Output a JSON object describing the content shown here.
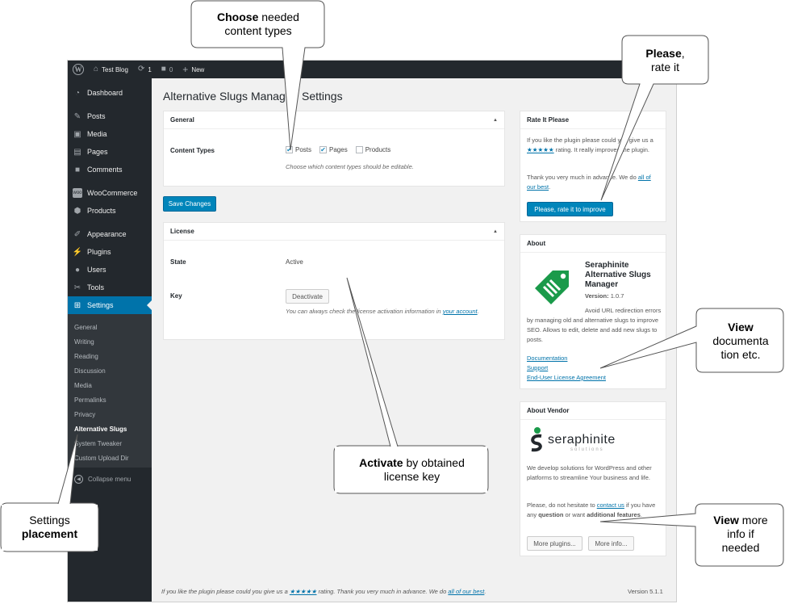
{
  "adminbar": {
    "site_name": "Test Blog",
    "updates_count": "1",
    "comments_count": "0",
    "new_label": "New"
  },
  "sidebar": {
    "items": [
      {
        "label": "Dashboard",
        "icon": "dashboard-icon"
      },
      {
        "label": "Posts",
        "icon": "pin-icon"
      },
      {
        "label": "Media",
        "icon": "media-icon"
      },
      {
        "label": "Pages",
        "icon": "pages-icon"
      },
      {
        "label": "Comments",
        "icon": "comment-icon"
      },
      {
        "label": "WooCommerce",
        "icon": "woo-icon"
      },
      {
        "label": "Products",
        "icon": "box-icon"
      },
      {
        "label": "Appearance",
        "icon": "brush-icon"
      },
      {
        "label": "Plugins",
        "icon": "plug-icon"
      },
      {
        "label": "Users",
        "icon": "user-icon"
      },
      {
        "label": "Tools",
        "icon": "wrench-icon"
      },
      {
        "label": "Settings",
        "icon": "settings-icon"
      }
    ],
    "submenu": [
      "General",
      "Writing",
      "Reading",
      "Discussion",
      "Media",
      "Permalinks",
      "Privacy",
      "Alternative Slugs",
      "System Tweaker",
      "Custom Upload Dir"
    ],
    "collapse_label": "Collapse menu"
  },
  "page_title": "Alternative Slugs Manager: Settings",
  "general": {
    "title": "General",
    "content_types_label": "Content Types",
    "options": [
      {
        "label": "Posts",
        "checked": true
      },
      {
        "label": "Pages",
        "checked": true
      },
      {
        "label": "Products",
        "checked": false
      }
    ],
    "description": "Choose which content types should be editable."
  },
  "save_button": "Save Changes",
  "license": {
    "title": "License",
    "state_label": "State",
    "state_value": "Active",
    "key_label": "Key",
    "deactivate_button": "Deactivate",
    "desc_prefix": "You can always check the license activation information in ",
    "desc_link": "your account",
    "desc_suffix": "."
  },
  "rate": {
    "title": "Rate It Please",
    "text1": "If you like the plugin please could you give us a ",
    "stars": "★★★★★",
    "text2": " rating. It really improves the plugin.",
    "thanks_prefix": "Thank you very much in advance. We do ",
    "thanks_link": "all of our best",
    "thanks_suffix": ".",
    "button": "Please, rate it to improve"
  },
  "about": {
    "title": "About",
    "name": "Seraphinite Alternative Slugs Manager",
    "version_label": "Version:",
    "version": "1.0.7",
    "description": "Avoid URL redirection errors by managing old and alternative slugs to improve SEO. Allows to edit, delete and add new slugs to posts.",
    "links": [
      "Documentation",
      "Support",
      "End-User License Agreement"
    ]
  },
  "vendor": {
    "title": "About Vendor",
    "logo_text": "seraphinite",
    "logo_sub": "solutions",
    "text": "We develop solutions for WordPress and other platforms to streamline Your business and life.",
    "hesitate_prefix": "Please, do not hesitate to ",
    "contact_link": "contact us",
    "hesitate_mid": " if you have any ",
    "question": "question",
    "hesitate_mid2": " or want ",
    "additional": "additional features",
    "hesitate_suffix": ".",
    "more_plugins": "More plugins...",
    "more_info": "More info..."
  },
  "footer": {
    "prefix": "If you like the plugin please could you give us a ",
    "stars": "★★★★★",
    "mid": " rating. Thank you very much in advance. We do ",
    "link": "all of our best",
    "suffix": ".",
    "version": "Version 5.1.1"
  },
  "callouts": {
    "choose": {
      "bold": "Choose",
      "rest1": " needed",
      "rest2": "content types"
    },
    "rate": {
      "bold": "Please",
      "rest1": ",",
      "rest2": "rate it"
    },
    "docs": {
      "bold": "View",
      "rest1": "documenta",
      "rest2": "tion etc."
    },
    "activate": {
      "bold": "Activate",
      "rest1": " by obtained",
      "rest2": "license key"
    },
    "settings": {
      "line1": "Settings",
      "bold": "placement"
    },
    "more": {
      "bold": "View",
      "rest1": " more",
      "rest2": "info if",
      "rest3": "needed"
    }
  },
  "colors": {
    "adminbar": "#23282d",
    "accent": "#0073aa",
    "button": "#0085ba",
    "background": "#f1f1f1"
  }
}
